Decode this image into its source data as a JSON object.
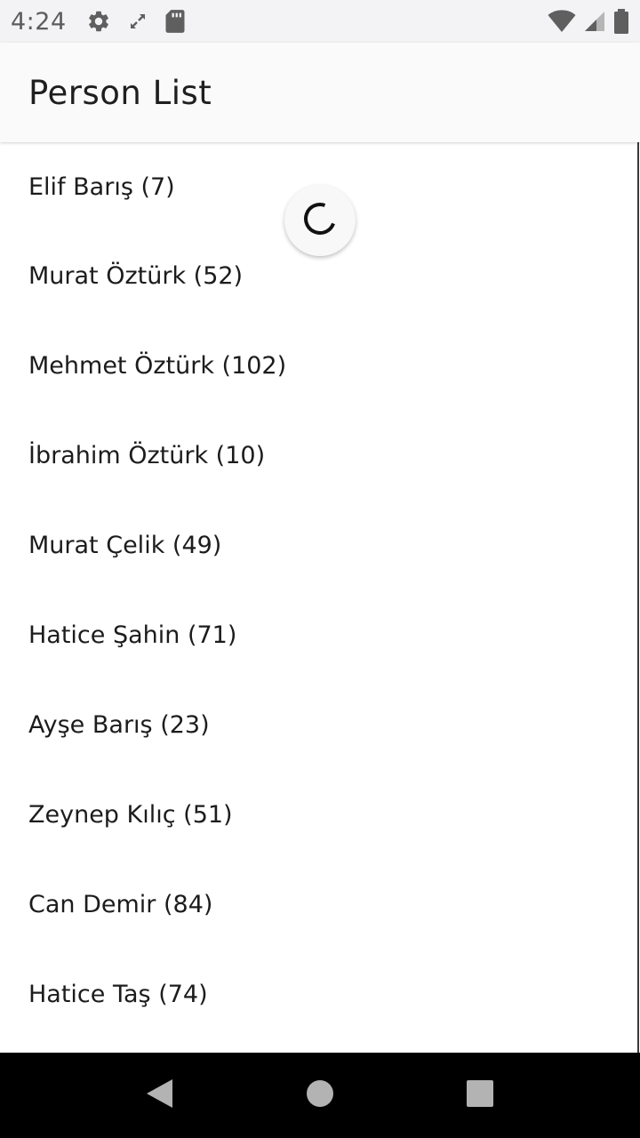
{
  "status_bar": {
    "time": "4:24",
    "left_icons": [
      "gear-icon",
      "fullscreen-icon",
      "sd-card-icon"
    ],
    "right_icons": [
      "wifi-icon",
      "cell-signal-icon",
      "battery-icon"
    ]
  },
  "app_bar": {
    "title": "Person List"
  },
  "persons": [
    "Elif Barış (7)",
    "Murat Öztürk (52)",
    "Mehmet Öztürk (102)",
    "İbrahim Öztürk (10)",
    "Murat Çelik (49)",
    "Hatice Şahin (71)",
    "Ayşe Barış (23)",
    "Zeynep Kılıç (51)",
    "Can Demir (84)",
    "Hatice Taş (74)"
  ],
  "loading_indicator": "refresh-spinner-icon",
  "nav_bar": {
    "buttons": [
      "back-icon",
      "home-icon",
      "recents-icon"
    ]
  },
  "colors": {
    "status_bar_bg": "#f3f3f6",
    "app_bar_bg": "#fafafa",
    "text": "#1c1c1c",
    "nav_bar_bg": "#000000",
    "nav_icon": "#b3b3b3"
  }
}
